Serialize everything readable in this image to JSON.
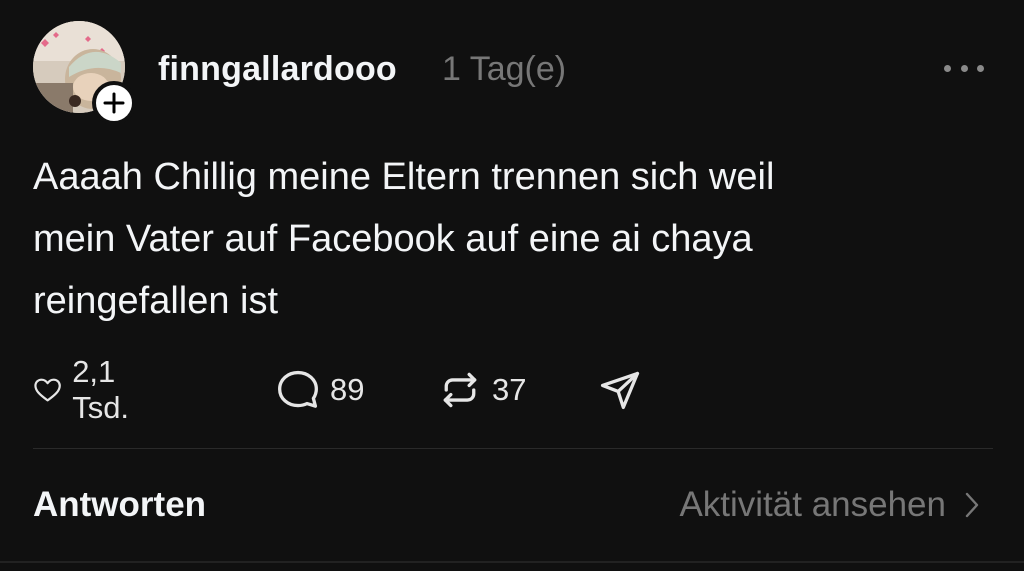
{
  "post": {
    "username": "finngallardooo",
    "timestamp": "1 Tag(e)",
    "text_lines": [
      "Aaaah Chillig meine Eltern trennen sich weil",
      "mein Vater auf Facebook auf eine ai chaya",
      "reingefallen ist"
    ]
  },
  "actions": {
    "likes": "2,1 Tsd.",
    "comments": "89",
    "reposts": "37"
  },
  "footer": {
    "replies_label": "Antworten",
    "activity_label": "Aktivität ansehen"
  },
  "icons": {
    "like": "heart-icon",
    "comment": "comment-bubble-icon",
    "repost": "repost-icon",
    "share": "send-icon",
    "more": "more-dots-icon",
    "follow": "plus-icon",
    "activity": "chevron-right-icon"
  },
  "colors": {
    "background": "#101010",
    "text": "#f3f5f7",
    "muted": "#777777"
  }
}
